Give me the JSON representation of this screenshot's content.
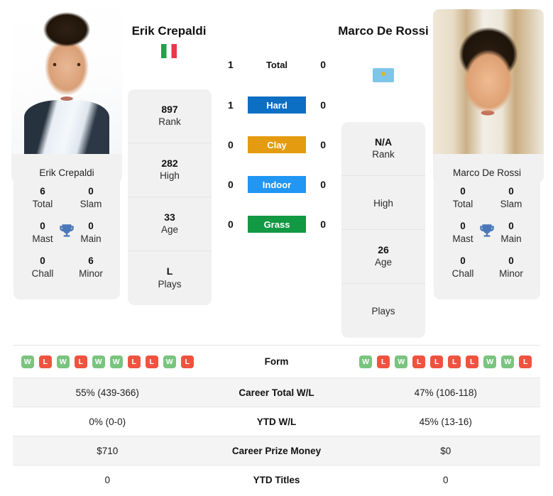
{
  "players": {
    "left": {
      "name": "Erik Crepaldi",
      "card_name": "Erik Crepaldi",
      "flag": "italy-flag",
      "rank": "897",
      "rank_label": "Rank",
      "high": "282",
      "high_label": "High",
      "age": "33",
      "age_label": "Age",
      "plays": "L",
      "plays_label": "Plays",
      "titles": {
        "heading": "Erik Crepaldi",
        "total": "6",
        "total_label": "Total",
        "slam": "0",
        "slam_label": "Slam",
        "mast": "0",
        "mast_label": "Mast",
        "main": "0",
        "main_label": "Main",
        "chall": "0",
        "chall_label": "Chall",
        "minor": "6",
        "minor_label": "Minor"
      },
      "form": [
        "W",
        "L",
        "W",
        "L",
        "W",
        "W",
        "L",
        "L",
        "W",
        "L"
      ],
      "career_total_wl": "55% (439-366)",
      "ytd_wl": "0% (0-0)",
      "career_prize_money": "$710",
      "ytd_titles": "0"
    },
    "right": {
      "name": "Marco De Rossi",
      "card_name": "Marco De Rossi",
      "flag": "argentina-flag",
      "rank": "N/A",
      "rank_label": "Rank",
      "high": "",
      "high_label": "High",
      "age": "26",
      "age_label": "Age",
      "plays": "",
      "plays_label": "Plays",
      "titles": {
        "heading": "Marco De Rossi",
        "total": "0",
        "total_label": "Total",
        "slam": "0",
        "slam_label": "Slam",
        "mast": "0",
        "mast_label": "Mast",
        "main": "0",
        "main_label": "Main",
        "chall": "0",
        "chall_label": "Chall",
        "minor": "0",
        "minor_label": "Minor"
      },
      "form": [
        "W",
        "L",
        "W",
        "L",
        "L",
        "L",
        "L",
        "W",
        "W",
        "L"
      ],
      "career_total_wl": "47% (106-118)",
      "ytd_wl": "45% (13-16)",
      "career_prize_money": "$0",
      "ytd_titles": "0"
    }
  },
  "h2h": [
    {
      "label": "Total",
      "left": "1",
      "right": "0",
      "color": ""
    },
    {
      "label": "Hard",
      "left": "1",
      "right": "0",
      "color": "#0d6fc4"
    },
    {
      "label": "Clay",
      "left": "0",
      "right": "0",
      "color": "#e49b0f"
    },
    {
      "label": "Indoor",
      "left": "0",
      "right": "0",
      "color": "#2196f3"
    },
    {
      "label": "Grass",
      "left": "0",
      "right": "0",
      "color": "#119944"
    }
  ],
  "table_rows": [
    {
      "label": "Form"
    },
    {
      "label": "Career Total W/L"
    },
    {
      "label": "YTD W/L"
    },
    {
      "label": "Career Prize Money"
    },
    {
      "label": "YTD Titles"
    }
  ],
  "colors": {
    "win_badge": "#7ac47f",
    "loss_badge": "#ef5340",
    "panel": "#f1f1f1",
    "row_shade": "#f4f4f4",
    "trophy": "#4a77b8"
  }
}
